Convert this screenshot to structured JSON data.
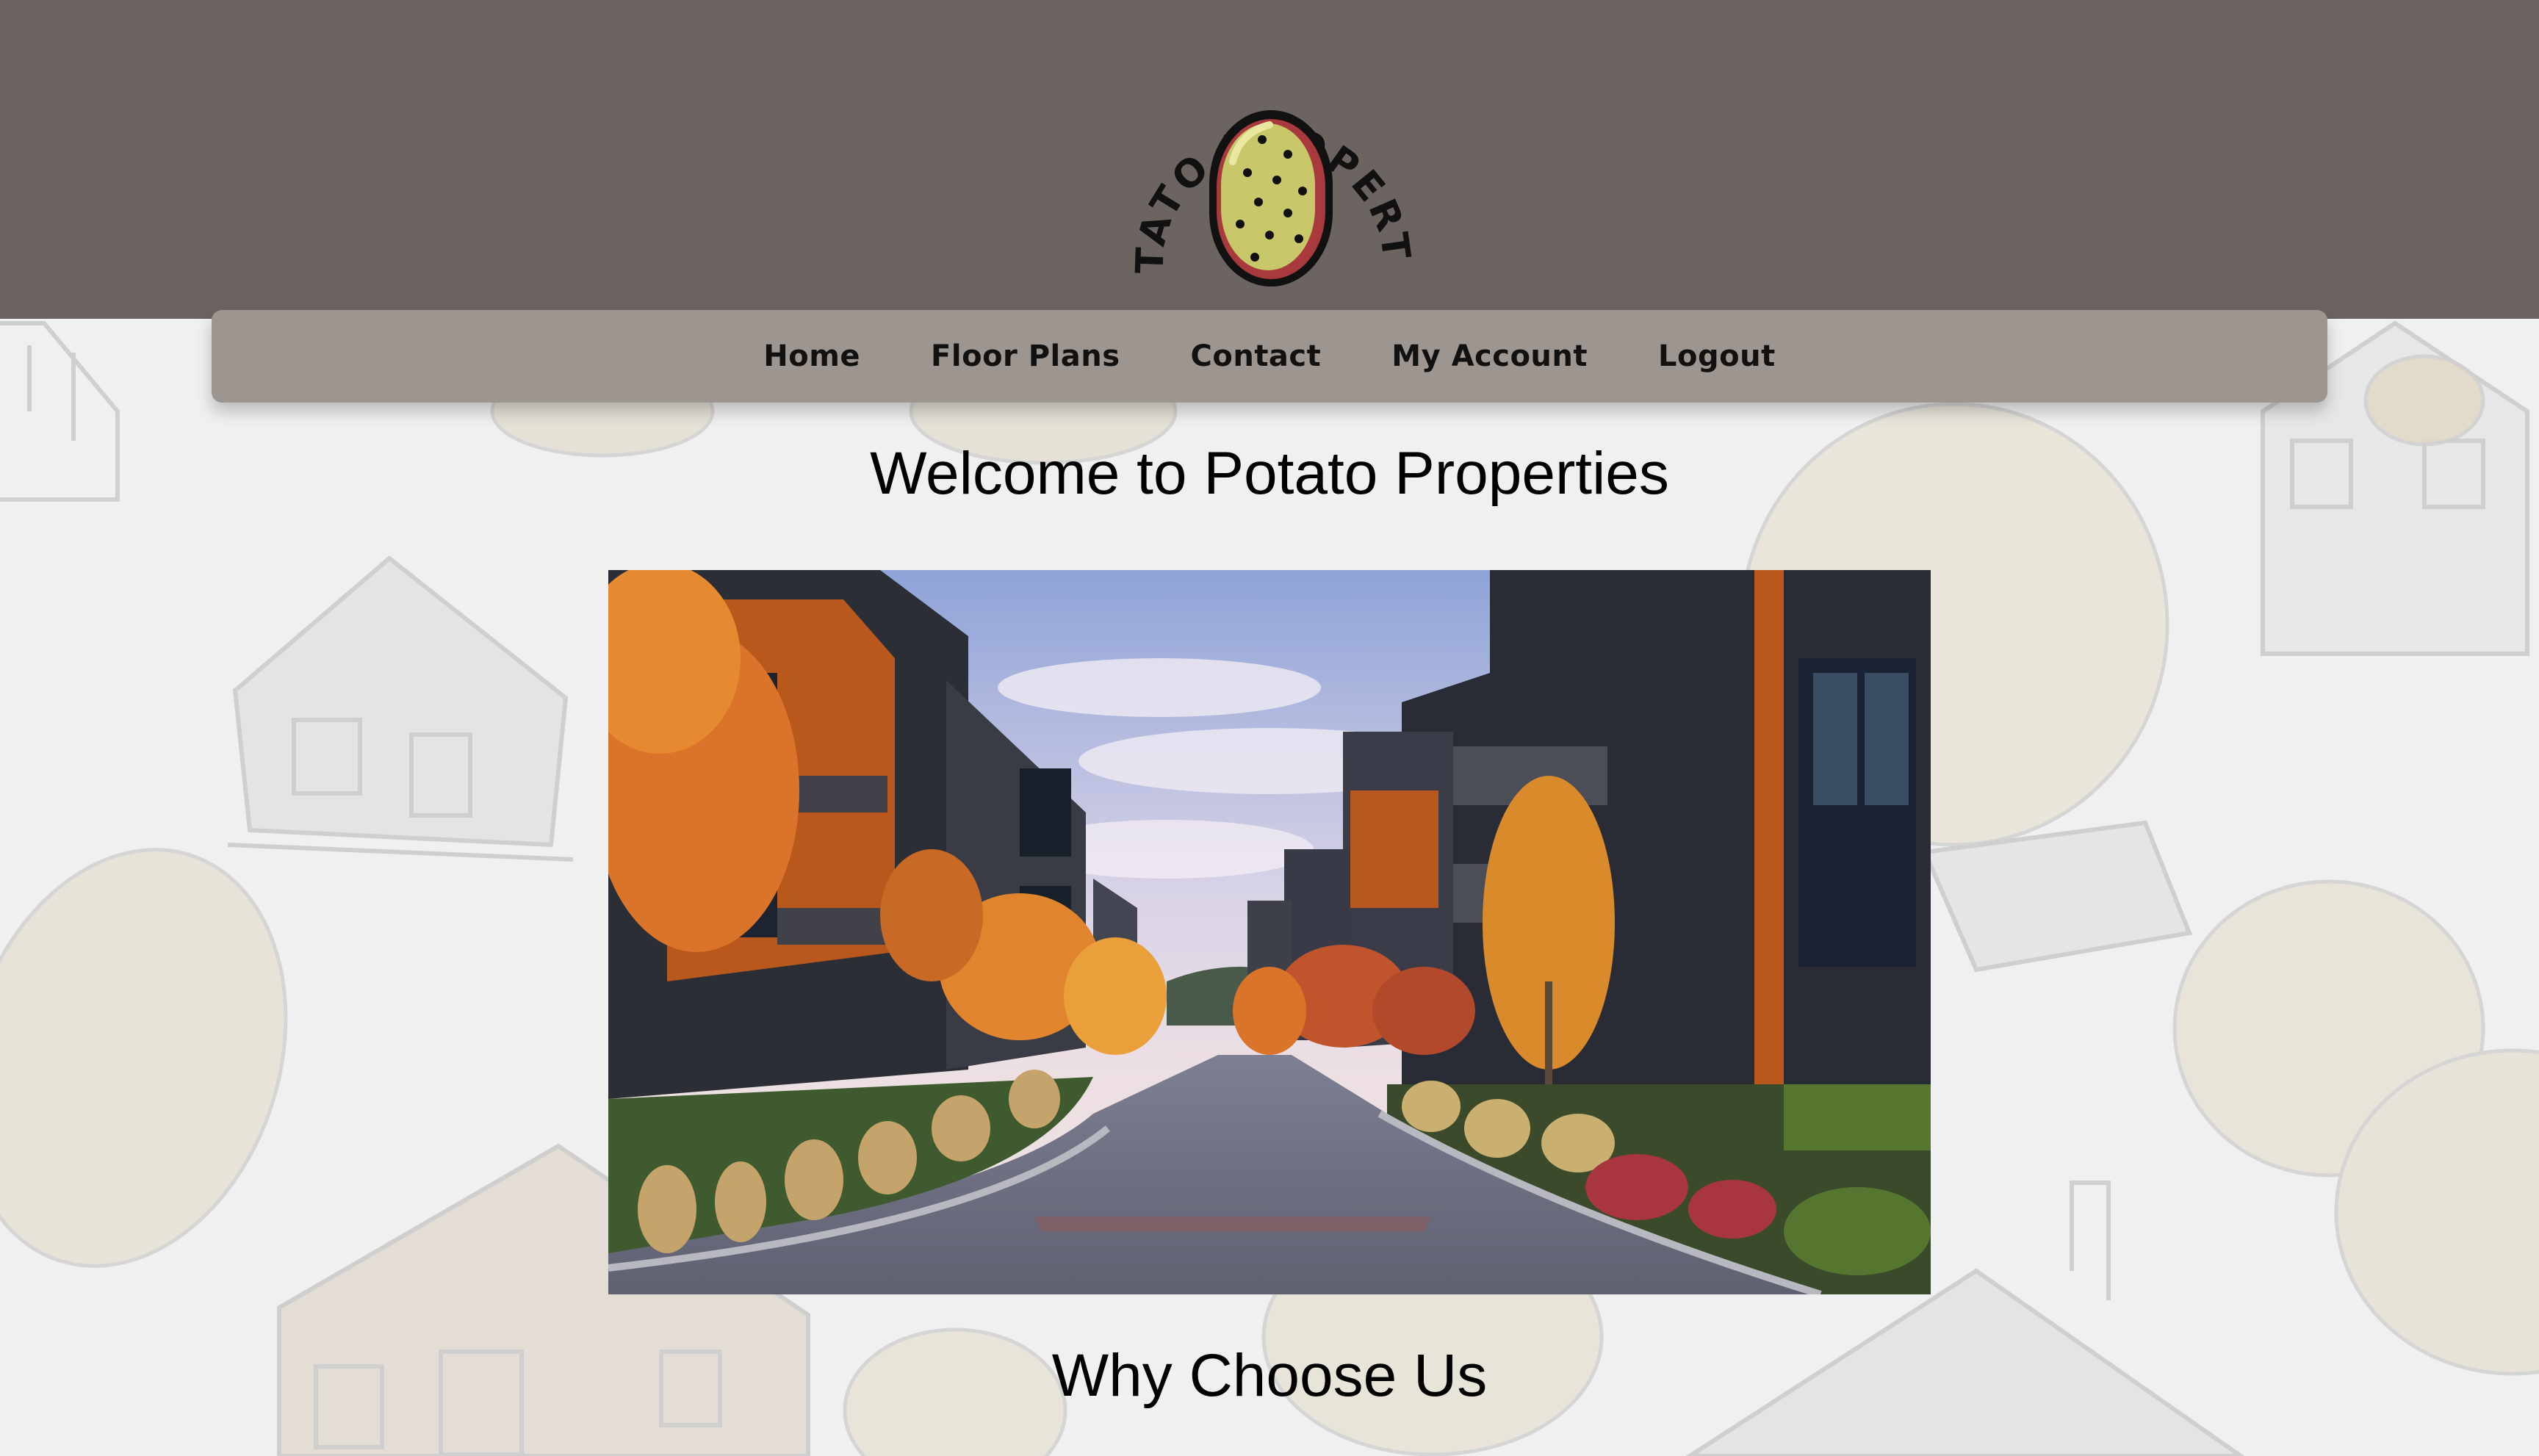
{
  "brand": {
    "logo_text": "POTATO PROPERTIES"
  },
  "nav": {
    "items": [
      {
        "label": "Home"
      },
      {
        "label": "Floor Plans"
      },
      {
        "label": "Contact"
      },
      {
        "label": "My Account"
      },
      {
        "label": "Logout"
      }
    ]
  },
  "main": {
    "welcome_title": "Welcome to Potato Properties",
    "why_title": "Why Choose Us"
  },
  "colors": {
    "header_bg": "#6b6461",
    "nav_bg": "#9c9590",
    "page_bg": "#f0f0f0",
    "potato_fill": "#c8c86a",
    "potato_rim": "#a83a3e"
  },
  "icons": {
    "logo": "potato-logo-icon",
    "hero": "apartment-street-image"
  }
}
